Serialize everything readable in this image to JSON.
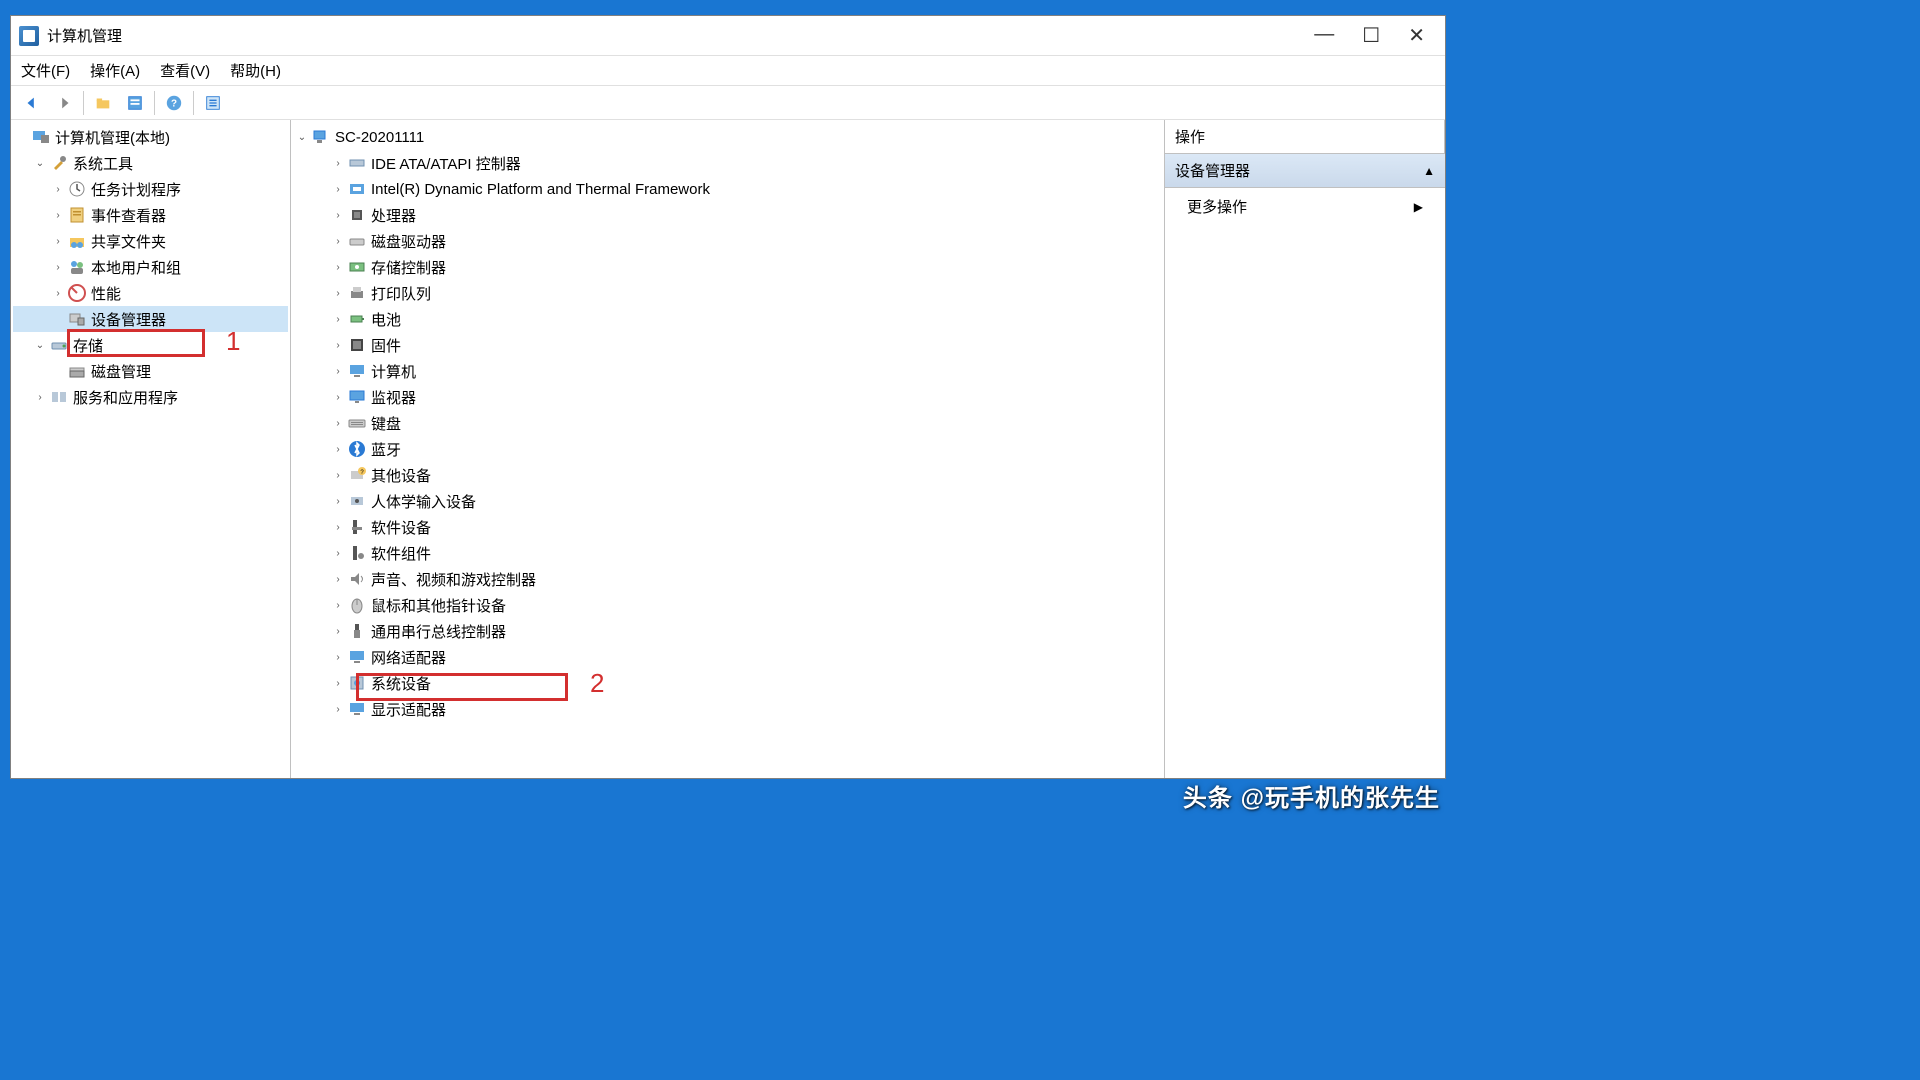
{
  "window": {
    "title": "计算机管理"
  },
  "menubar": {
    "file": "文件(F)",
    "action": "操作(A)",
    "view": "查看(V)",
    "help": "帮助(H)"
  },
  "left_tree": {
    "root": "计算机管理(本地)",
    "system_tools": "系统工具",
    "task_scheduler": "任务计划程序",
    "event_viewer": "事件查看器",
    "shared_folders": "共享文件夹",
    "local_users": "本地用户和组",
    "performance": "性能",
    "device_manager": "设备管理器",
    "storage": "存储",
    "disk_management": "磁盘管理",
    "services_apps": "服务和应用程序"
  },
  "device_tree": {
    "root": "SC-20201111",
    "items": [
      {
        "label": "IDE ATA/ATAPI 控制器",
        "icon": "ide"
      },
      {
        "label": "Intel(R) Dynamic Platform and Thermal Framework",
        "icon": "intel"
      },
      {
        "label": "处理器",
        "icon": "cpu"
      },
      {
        "label": "磁盘驱动器",
        "icon": "disk"
      },
      {
        "label": "存储控制器",
        "icon": "storage"
      },
      {
        "label": "打印队列",
        "icon": "printer"
      },
      {
        "label": "电池",
        "icon": "battery"
      },
      {
        "label": "固件",
        "icon": "firmware"
      },
      {
        "label": "计算机",
        "icon": "computer"
      },
      {
        "label": "监视器",
        "icon": "monitor"
      },
      {
        "label": "键盘",
        "icon": "keyboard"
      },
      {
        "label": "蓝牙",
        "icon": "bluetooth"
      },
      {
        "label": "其他设备",
        "icon": "other"
      },
      {
        "label": "人体学输入设备",
        "icon": "hid"
      },
      {
        "label": "软件设备",
        "icon": "software"
      },
      {
        "label": "软件组件",
        "icon": "component"
      },
      {
        "label": "声音、视频和游戏控制器",
        "icon": "sound"
      },
      {
        "label": "鼠标和其他指针设备",
        "icon": "mouse"
      },
      {
        "label": "通用串行总线控制器",
        "icon": "usb"
      },
      {
        "label": "网络适配器",
        "icon": "network"
      },
      {
        "label": "系统设备",
        "icon": "system"
      },
      {
        "label": "显示适配器",
        "icon": "display"
      }
    ]
  },
  "actions": {
    "header": "操作",
    "subheader": "设备管理器",
    "more": "更多操作"
  },
  "annotations": {
    "label1": "1",
    "label2": "2"
  },
  "watermark": "头条 @玩手机的张先生"
}
